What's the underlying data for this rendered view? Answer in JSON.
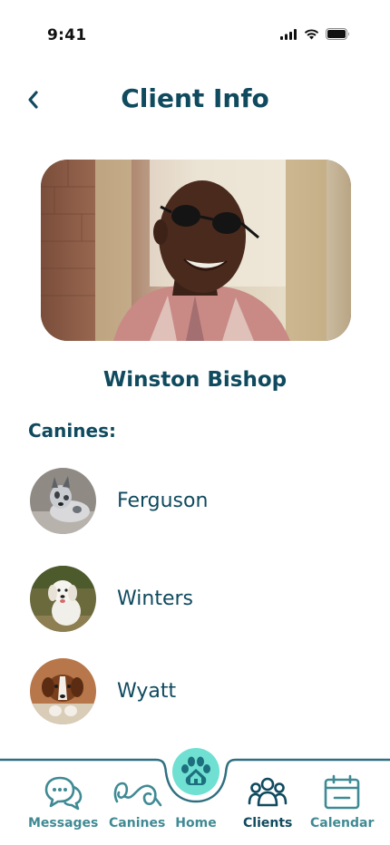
{
  "status": {
    "time": "9:41"
  },
  "header": {
    "title": "Client Info"
  },
  "client": {
    "name": "Winston Bishop"
  },
  "canines": {
    "heading": "Canines:",
    "items": [
      {
        "name": "Ferguson"
      },
      {
        "name": "Winters"
      },
      {
        "name": "Wyatt"
      }
    ]
  },
  "nav": {
    "items": [
      {
        "label": "Messages",
        "icon": "messages-icon"
      },
      {
        "label": "Canines",
        "icon": "leash-icon"
      },
      {
        "label": "Home",
        "icon": "paw-home-icon"
      },
      {
        "label": "Clients",
        "icon": "clients-icon",
        "active": true
      },
      {
        "label": "Calendar",
        "icon": "calendar-icon"
      }
    ]
  },
  "colors": {
    "primary": "#0f4a5e",
    "accent": "#6fe0d2",
    "nav_inactive": "#3f8a94"
  }
}
